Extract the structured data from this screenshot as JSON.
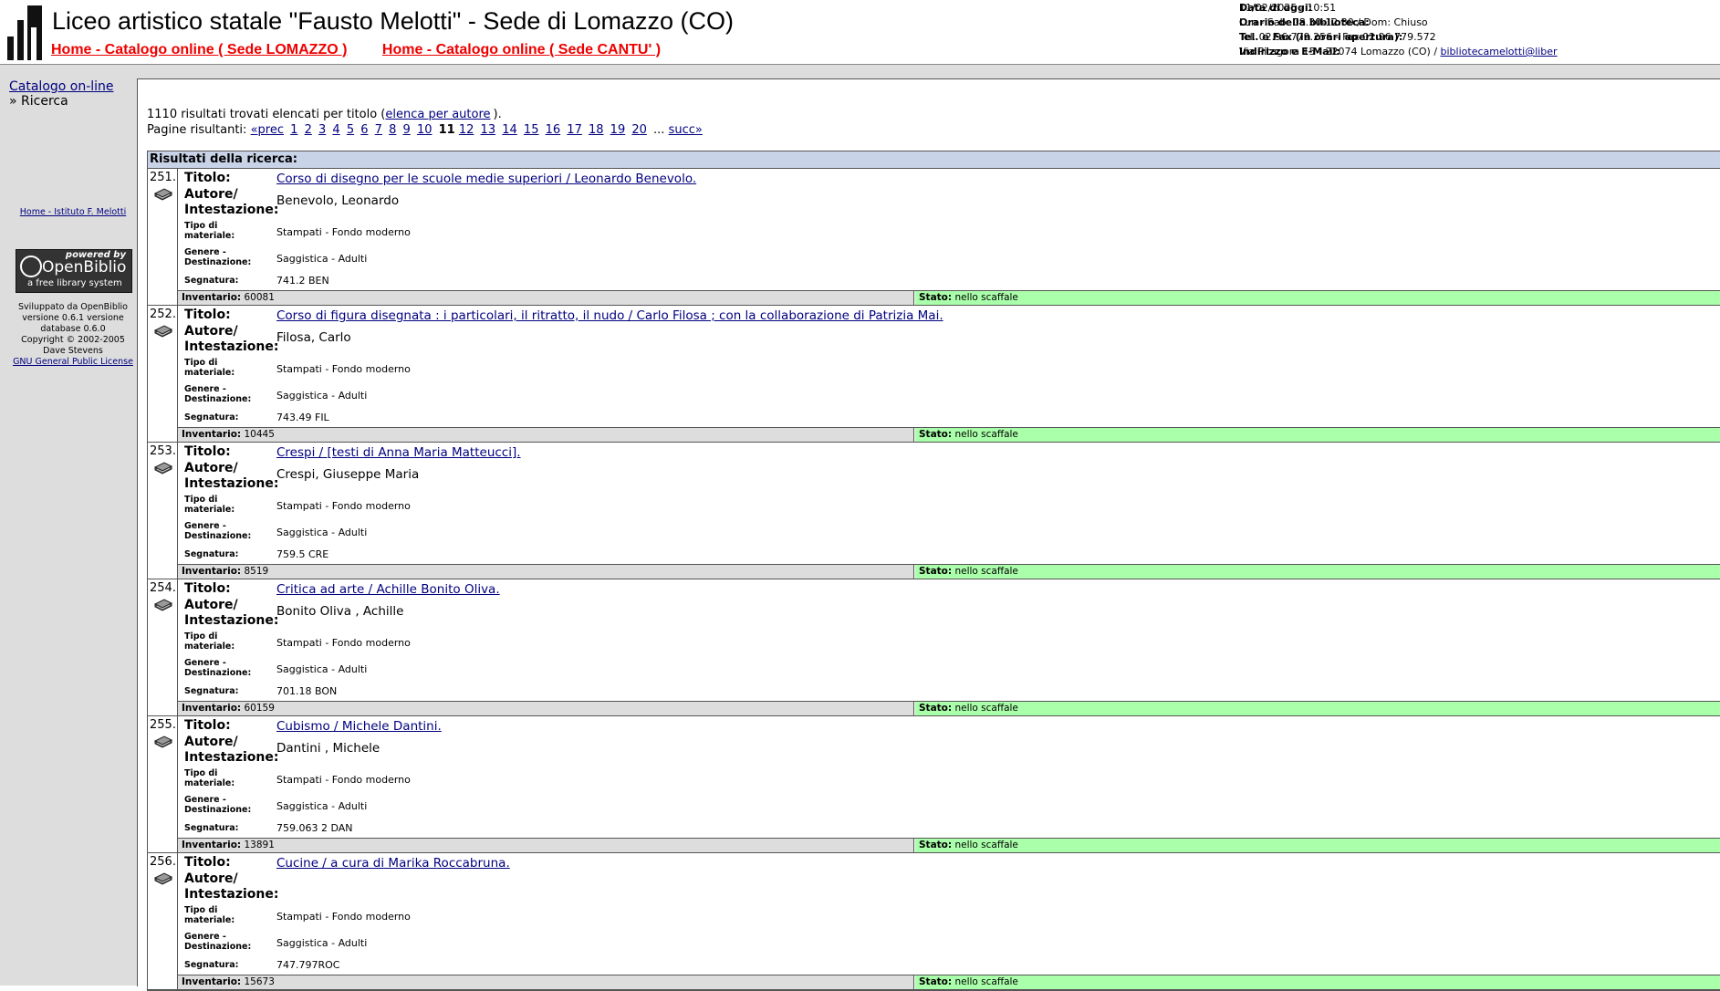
{
  "header": {
    "title": "Liceo artistico statale \"Fausto Melotti\" - Sede di Lomazzo (CO)",
    "links": [
      "Home - Catalogo online ( Sede LOMAZZO )",
      "Home - Catalogo online ( Sede CANTU' )"
    ],
    "info": [
      {
        "label": "Data di oggi:",
        "value": "11/02/2025 - 10:51"
      },
      {
        "label": "Orario della biblioteca:",
        "value": "Lun - Sab: 08.30-12.30 / Dom: Chiuso"
      },
      {
        "label": "Tel. e Fax (in orari apertura):",
        "value": "Tel. 02.96.779.256 - Fax 02.96.779.572"
      },
      {
        "label": "Indirizzo e E-Mail:",
        "value": "Via Pitagora 15 - 22074 Lomazzo (CO) / ",
        "link": "bibliotecamelotti@liber"
      }
    ]
  },
  "sidebar": {
    "catalog_link": "Catalogo on-line",
    "current": "» Ricerca",
    "home_istituto": "Home - Istituto F. Melotti",
    "powered": {
      "line1": "powered by",
      "line2": "OpenBiblio",
      "line3": "a free library system"
    },
    "credits": [
      "Sviluppato da OpenBiblio",
      "versione 0.6.1 versione",
      "database 0.6.0",
      "Copyright © 2002-2005",
      "Dave Stevens"
    ],
    "license": "GNU General Public License"
  },
  "summary": {
    "text_before": "1110 risultati trovati elencati per titolo (",
    "link": "elenca per autore",
    "text_after": ").",
    "pages_label": "Pagine risultanti:",
    "prev": "«prec",
    "pages": [
      "1",
      "2",
      "3",
      "4",
      "5",
      "6",
      "7",
      "8",
      "9",
      "10",
      "11",
      "12",
      "13",
      "14",
      "15",
      "16",
      "17",
      "18",
      "19",
      "20"
    ],
    "current_page": "11",
    "ellipsis": "...",
    "next": "succ»"
  },
  "results": {
    "header": "Risultati della ricerca:",
    "labels": {
      "titolo": "Titolo:",
      "autore": "Autore/ Intestazione:",
      "tipo": "Tipo di materiale:",
      "genere": "Genere - Destinazione:",
      "segnatura": "Segnatura:",
      "inventario": "Inventario:",
      "stato": "Stato:"
    },
    "records": [
      {
        "num": "251.",
        "title": "Corso di disegno per le scuole medie superiori / Leonardo Benevolo.",
        "author": "Benevolo, Leonardo",
        "tipo": "Stampati - Fondo moderno",
        "genere": "Saggistica - Adulti",
        "segnatura": "741.2 BEN",
        "inventario": "60081",
        "stato": "nello scaffale"
      },
      {
        "num": "252.",
        "title": "Corso di figura disegnata : i particolari, il ritratto, il nudo / Carlo Filosa ; con la collaborazione di Patrizia Mai.",
        "author": "Filosa, Carlo",
        "tipo": "Stampati - Fondo moderno",
        "genere": "Saggistica - Adulti",
        "segnatura": "743.49 FIL",
        "inventario": "10445",
        "stato": "nello scaffale"
      },
      {
        "num": "253.",
        "title": "Crespi / [testi di Anna Maria Matteucci].",
        "author": "Crespi, Giuseppe Maria",
        "tipo": "Stampati - Fondo moderno",
        "genere": "Saggistica - Adulti",
        "segnatura": "759.5 CRE",
        "inventario": "8519",
        "stato": "nello scaffale"
      },
      {
        "num": "254.",
        "title": "Critica ad arte / Achille Bonito Oliva.",
        "author": "Bonito Oliva , Achille",
        "tipo": "Stampati - Fondo moderno",
        "genere": "Saggistica - Adulti",
        "segnatura": "701.18 BON",
        "inventario": "60159",
        "stato": "nello scaffale"
      },
      {
        "num": "255.",
        "title": "Cubismo / Michele Dantini.",
        "author": "Dantini , Michele",
        "tipo": "Stampati - Fondo moderno",
        "genere": "Saggistica - Adulti",
        "segnatura": "759.063 2 DAN",
        "inventario": "13891",
        "stato": "nello scaffale"
      },
      {
        "num": "256.",
        "title": "Cucine / a cura di Marika Roccabruna.",
        "author": "",
        "tipo": "Stampati - Fondo moderno",
        "genere": "Saggistica - Adulti",
        "segnatura": "747.797ROC",
        "inventario": "15673",
        "stato": "nello scaffale"
      }
    ]
  }
}
